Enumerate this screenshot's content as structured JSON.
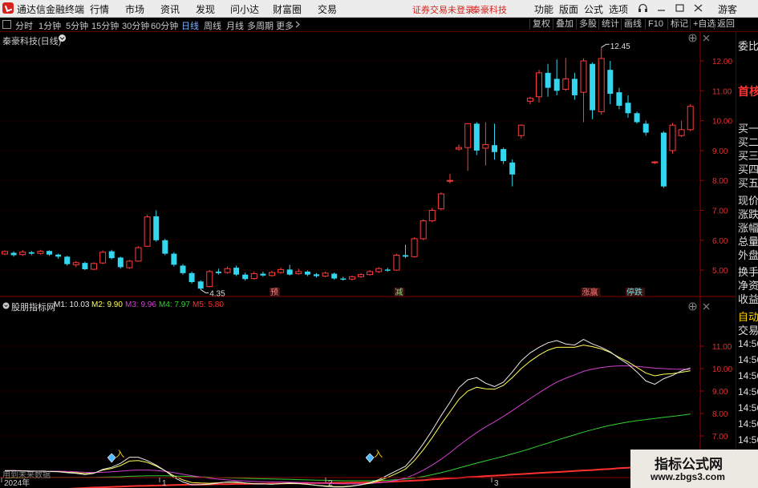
{
  "app": {
    "name": "通达信金融终端",
    "status": "证券交易未登录",
    "stock_name": "秦豪科技",
    "guest": "游客"
  },
  "menu": [
    "行情",
    "市场",
    "资讯",
    "发现",
    "问小达",
    "财富圈",
    "交易"
  ],
  "right_menu": [
    "功能",
    "版面",
    "公式",
    "选项"
  ],
  "periods": [
    "分时",
    "1分钟",
    "5分钟",
    "15分钟",
    "30分钟",
    "60分钟",
    "日线",
    "周线",
    "月线",
    "多周期",
    "更多"
  ],
  "tool_buttons": [
    "复权",
    "叠加",
    "多股",
    "统计",
    "画线",
    "F10",
    "标记",
    "+自选",
    "返回"
  ],
  "chart": {
    "title": "秦豪科技(日线)"
  },
  "indicator": {
    "name": "股朋指标网",
    "lines": [
      {
        "label": "M1: 10.03",
        "color": "#e8e8e8"
      },
      {
        "label": "M2: 9.90",
        "color": "#ffff55"
      },
      {
        "label": "M3: 9.96",
        "color": "#d040d0"
      },
      {
        "label": "M4: 7.97",
        "color": "#30d030"
      },
      {
        "label": "M5: 5.80",
        "color": "#ff3030"
      }
    ],
    "hint": "用到未来数据",
    "buy_marker": "入"
  },
  "chart_data": {
    "type": "candlestick",
    "price_axis": [
      "12.00",
      "11.00",
      "10.00",
      "9.00",
      "8.00",
      "7.00",
      "6.00",
      "5.00"
    ],
    "high_label": "12.45",
    "low_label": "4.35",
    "tags": [
      "预",
      "减",
      "涨赢",
      "停跌"
    ],
    "indicator_axis": [
      "11.00",
      "10.00",
      "9.00",
      "8.00",
      "7.00",
      "6.00"
    ],
    "x_labels": [
      "2024年",
      "1",
      "2",
      "3"
    ],
    "candles": [
      [
        5.54,
        5.62,
        5.66,
        5.5
      ],
      [
        5.58,
        5.5,
        5.63,
        5.45
      ],
      [
        5.52,
        5.6,
        5.67,
        5.48
      ],
      [
        5.6,
        5.55,
        5.64,
        5.5
      ],
      [
        5.56,
        5.63,
        5.68,
        5.52
      ],
      [
        5.64,
        5.52,
        5.66,
        5.48
      ],
      [
        5.52,
        5.45,
        5.55,
        5.38
      ],
      [
        5.45,
        5.2,
        5.48,
        5.15
      ],
      [
        5.18,
        5.25,
        5.3,
        5.1
      ],
      [
        5.24,
        5.03,
        5.28,
        5.0
      ],
      [
        5.03,
        5.22,
        5.26,
        5.0
      ],
      [
        5.24,
        5.6,
        5.66,
        5.2
      ],
      [
        5.63,
        5.4,
        5.68,
        5.36
      ],
      [
        5.42,
        5.1,
        5.45,
        5.05
      ],
      [
        5.08,
        5.3,
        5.34,
        5.04
      ],
      [
        5.3,
        5.75,
        5.8,
        5.28
      ],
      [
        5.8,
        6.78,
        6.85,
        5.78
      ],
      [
        6.8,
        6.0,
        7.0,
        5.95
      ],
      [
        6.0,
        5.55,
        6.05,
        5.5
      ],
      [
        5.55,
        5.18,
        5.6,
        5.12
      ],
      [
        5.15,
        4.9,
        5.2,
        4.85
      ],
      [
        4.9,
        4.6,
        4.95,
        4.55
      ],
      [
        4.62,
        4.38,
        4.66,
        4.35
      ],
      [
        4.45,
        4.95,
        5.0,
        4.42
      ],
      [
        4.95,
        4.9,
        5.05,
        4.85
      ],
      [
        4.92,
        5.05,
        5.12,
        4.88
      ],
      [
        5.08,
        4.85,
        5.15,
        4.8
      ],
      [
        4.85,
        4.7,
        4.92,
        4.65
      ],
      [
        4.72,
        4.88,
        4.95,
        4.68
      ],
      [
        4.88,
        4.82,
        4.95,
        4.78
      ],
      [
        4.82,
        4.92,
        4.98,
        4.78
      ],
      [
        4.92,
        5.02,
        5.08,
        4.88
      ],
      [
        5.02,
        4.85,
        5.18,
        4.82
      ],
      [
        4.88,
        4.95,
        5.05,
        4.85
      ],
      [
        4.95,
        4.85,
        4.99,
        4.8
      ],
      [
        4.86,
        4.8,
        4.9,
        4.75
      ],
      [
        4.8,
        4.9,
        4.95,
        4.76
      ],
      [
        4.88,
        4.72,
        4.92,
        4.68
      ],
      [
        4.72,
        4.68,
        4.78,
        4.65
      ],
      [
        4.7,
        4.78,
        4.82,
        4.66
      ],
      [
        4.78,
        4.85,
        4.9,
        4.74
      ],
      [
        4.85,
        4.95,
        5.0,
        4.82
      ],
      [
        4.95,
        5.05,
        5.1,
        4.9
      ],
      [
        5.02,
        4.98,
        5.08,
        4.95
      ],
      [
        5.0,
        5.5,
        5.55,
        4.98
      ],
      [
        5.5,
        5.45,
        5.85,
        5.4
      ],
      [
        5.45,
        6.05,
        6.1,
        5.42
      ],
      [
        6.05,
        6.65,
        6.7,
        6.0
      ],
      [
        6.65,
        7.0,
        7.08,
        6.6
      ],
      [
        7.05,
        7.55,
        7.6,
        7.0
      ],
      [
        7.98,
        8.0,
        8.22,
        7.9
      ],
      [
        9.05,
        9.1,
        9.2,
        9.0
      ],
      [
        9.1,
        9.9,
        9.92,
        8.32
      ],
      [
        9.9,
        9.0,
        9.95,
        8.85
      ],
      [
        9.08,
        9.2,
        9.95,
        8.5
      ],
      [
        9.18,
        8.95,
        9.9,
        8.7
      ],
      [
        9.05,
        8.65,
        9.1,
        8.55
      ],
      [
        8.6,
        8.2,
        8.7,
        7.8
      ],
      [
        9.5,
        9.85,
        9.88,
        9.4
      ],
      [
        10.65,
        10.75,
        10.8,
        10.55
      ],
      [
        10.8,
        11.6,
        11.7,
        10.6
      ],
      [
        11.6,
        11.1,
        11.9,
        10.8
      ],
      [
        11.4,
        11.0,
        12.05,
        10.85
      ],
      [
        11.05,
        11.4,
        12.1,
        11.0
      ],
      [
        11.4,
        10.85,
        11.6,
        10.7
      ],
      [
        10.95,
        12.0,
        12.08,
        9.95
      ],
      [
        11.9,
        10.35,
        11.95,
        10.05
      ],
      [
        10.3,
        12.08,
        12.45,
        10.2
      ],
      [
        11.7,
        10.9,
        12.0,
        10.55
      ],
      [
        10.95,
        10.5,
        11.1,
        10.38
      ],
      [
        10.6,
        10.25,
        10.85,
        10.1
      ],
      [
        10.25,
        9.95,
        10.3,
        9.9
      ],
      [
        9.9,
        9.6,
        10.0,
        9.5
      ],
      [
        8.6,
        8.62,
        8.65,
        8.55
      ],
      [
        9.6,
        7.8,
        9.65,
        7.75
      ],
      [
        9.0,
        9.85,
        9.92,
        8.9
      ],
      [
        9.5,
        9.7,
        10.0,
        9.45
      ],
      [
        9.7,
        10.48,
        10.55,
        9.65
      ]
    ],
    "ind_series": {
      "M1": [
        5.44,
        5.45,
        5.44,
        5.43,
        5.43,
        5.41,
        5.4,
        5.36,
        5.33,
        5.28,
        5.33,
        5.51,
        5.6,
        5.78,
        6.05,
        6.05,
        5.9,
        5.7,
        5.45,
        5.15,
        4.95,
        4.82,
        4.83,
        4.85,
        4.9,
        4.95,
        4.95,
        4.9,
        4.86,
        4.86,
        4.85,
        4.88,
        4.9,
        4.88,
        4.85,
        4.8,
        4.75,
        4.72,
        4.72,
        4.76,
        4.82,
        4.92,
        5.05,
        5.25,
        5.45,
        5.65,
        6.1,
        6.65,
        7.25,
        7.9,
        8.5,
        9.15,
        9.5,
        9.6,
        9.35,
        9.2,
        9.4,
        9.85,
        10.35,
        10.7,
        10.95,
        11.15,
        11.25,
        11.1,
        11.05,
        11.3,
        11.1,
        10.95,
        10.75,
        10.45,
        10.2,
        9.85,
        9.45,
        9.3,
        9.55,
        9.7,
        9.9,
        10.03
      ],
      "M2": [
        5.45,
        5.45,
        5.44,
        5.43,
        5.43,
        5.42,
        5.41,
        5.38,
        5.36,
        5.32,
        5.34,
        5.48,
        5.55,
        5.68,
        5.88,
        5.9,
        5.82,
        5.66,
        5.45,
        5.22,
        5.04,
        4.92,
        4.9,
        4.89,
        4.91,
        4.94,
        4.93,
        4.9,
        4.87,
        4.86,
        4.85,
        4.87,
        4.88,
        4.87,
        4.84,
        4.8,
        4.77,
        4.74,
        4.74,
        4.77,
        4.82,
        4.89,
        5.0,
        5.15,
        5.33,
        5.52,
        5.9,
        6.38,
        6.92,
        7.52,
        8.07,
        8.63,
        9.0,
        9.17,
        9.1,
        9.08,
        9.25,
        9.6,
        10.0,
        10.33,
        10.6,
        10.82,
        10.95,
        10.95,
        10.95,
        11.05,
        10.98,
        10.88,
        10.72,
        10.5,
        10.3,
        10.05,
        9.8,
        9.68,
        9.75,
        9.78,
        9.84,
        9.9
      ],
      "M3": [
        5.46,
        5.46,
        5.45,
        5.44,
        5.44,
        5.43,
        5.43,
        5.42,
        5.4,
        5.38,
        5.37,
        5.38,
        5.4,
        5.43,
        5.46,
        5.48,
        5.48,
        5.46,
        5.42,
        5.36,
        5.29,
        5.23,
        5.17,
        5.11,
        5.07,
        5.04,
        5.01,
        4.99,
        4.97,
        4.96,
        4.95,
        4.95,
        4.94,
        4.93,
        4.92,
        4.9,
        4.89,
        4.87,
        4.86,
        4.86,
        4.86,
        4.88,
        4.91,
        4.96,
        5.03,
        5.12,
        5.28,
        5.47,
        5.7,
        5.96,
        6.25,
        6.57,
        6.87,
        7.15,
        7.4,
        7.63,
        7.87,
        8.13,
        8.4,
        8.66,
        8.92,
        9.17,
        9.4,
        9.57,
        9.72,
        9.88,
        9.98,
        10.05,
        10.1,
        10.12,
        10.12,
        10.1,
        10.06,
        10.02,
        10.0,
        9.98,
        9.97,
        9.96
      ],
      "M4": [
        5.12,
        5.13,
        5.13,
        5.14,
        5.14,
        5.15,
        5.15,
        5.15,
        5.15,
        5.15,
        5.15,
        5.16,
        5.17,
        5.18,
        5.2,
        5.21,
        5.22,
        5.22,
        5.22,
        5.21,
        5.2,
        5.19,
        5.17,
        5.16,
        5.14,
        5.13,
        5.12,
        5.11,
        5.1,
        5.09,
        5.08,
        5.07,
        5.06,
        5.05,
        5.04,
        5.03,
        5.02,
        5.01,
        5.0,
        5.0,
        5.0,
        5.0,
        5.01,
        5.03,
        5.05,
        5.08,
        5.13,
        5.19,
        5.27,
        5.36,
        5.46,
        5.57,
        5.68,
        5.79,
        5.89,
        5.99,
        6.09,
        6.2,
        6.31,
        6.43,
        6.56,
        6.68,
        6.81,
        6.93,
        7.05,
        7.17,
        7.28,
        7.38,
        7.47,
        7.55,
        7.62,
        7.68,
        7.73,
        7.78,
        7.83,
        7.87,
        7.92,
        7.97
      ],
      "M5": [
        4.5,
        4.52,
        4.54,
        4.56,
        4.58,
        4.6,
        4.62,
        4.64,
        4.66,
        4.68,
        4.7,
        4.71,
        4.73,
        4.74,
        4.76,
        4.77,
        4.78,
        4.79,
        4.8,
        4.81,
        4.82,
        4.83,
        4.83,
        4.84,
        4.85,
        4.85,
        4.86,
        4.86,
        4.87,
        4.87,
        4.88,
        4.88,
        4.89,
        4.89,
        4.9,
        4.9,
        4.9,
        4.91,
        4.91,
        4.92,
        4.92,
        4.93,
        4.94,
        4.95,
        4.97,
        4.99,
        5.01,
        5.03,
        5.06,
        5.08,
        5.11,
        5.13,
        5.16,
        5.18,
        5.21,
        5.23,
        5.25,
        5.28,
        5.3,
        5.32,
        5.35,
        5.37,
        5.39,
        5.41,
        5.44,
        5.46,
        5.48,
        5.51,
        5.53,
        5.56,
        5.58,
        5.61,
        5.64,
        5.67,
        5.7,
        5.73,
        5.76,
        5.8
      ]
    }
  }
}
